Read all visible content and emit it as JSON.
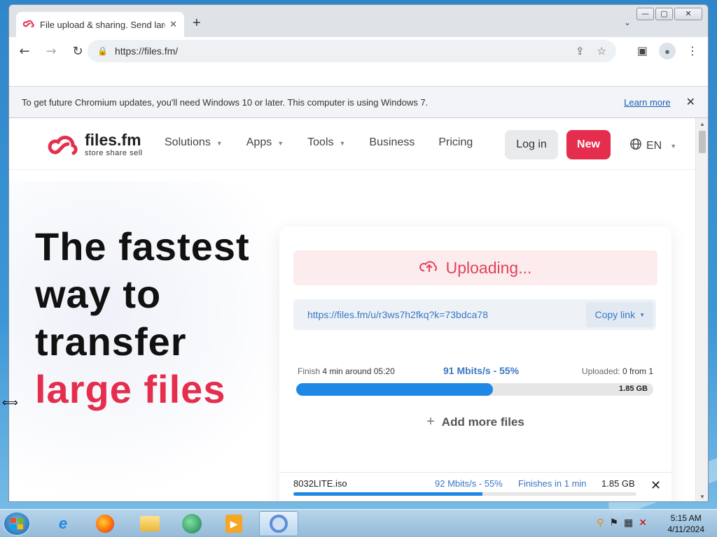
{
  "browser": {
    "tab_title": "File upload & sharing. Send large",
    "tab_close": "✕",
    "new_tab": "+",
    "url": "https://files.fm/",
    "window_controls": {
      "minimize": "—",
      "maximize": "▢",
      "close": "✕"
    }
  },
  "infobar": {
    "message": "To get future Chromium updates, you'll need Windows 10 or later. This computer is using Windows 7.",
    "learn_more": "Learn more",
    "close": "✕"
  },
  "site": {
    "logo_name": "files.fm",
    "logo_tagline": "store share sell",
    "nav": [
      {
        "label": "Solutions",
        "dropdown": true
      },
      {
        "label": "Apps",
        "dropdown": true
      },
      {
        "label": "Tools",
        "dropdown": true
      },
      {
        "label": "Business",
        "dropdown": false
      },
      {
        "label": "Pricing",
        "dropdown": false
      }
    ],
    "login_label": "Log in",
    "new_label": "New",
    "lang_label": "EN"
  },
  "hero": {
    "line1": "The fastest",
    "line2": "way to",
    "line3": "transfer",
    "line4": "large files"
  },
  "upload": {
    "status": "Uploading...",
    "share_url": "https://files.fm/u/r3ws7h2fkq?k=73bdca78",
    "copy_label": "Copy link",
    "finish_prefix": "Finish",
    "finish_value": "4 min around 05:20",
    "speed": "91 Mbits/s - 55%",
    "uploaded_prefix": "Uploaded:",
    "uploaded_value": "0 from 1",
    "total_size": "1.85 GB",
    "progress": 0.55,
    "add_more": "Add more files"
  },
  "file": {
    "name": "8032LITE.iso",
    "speed": "92 Mbits/s - 55%",
    "finishes": "Finishes in 1 min",
    "size": "1.85 GB",
    "progress": 0.55
  },
  "taskbar": {
    "time": "5:15 AM",
    "date": "4/11/2024"
  },
  "colors": {
    "brand_red": "#e52e4d",
    "progress_blue": "#1e88e5",
    "link_blue": "#3a77c4"
  }
}
